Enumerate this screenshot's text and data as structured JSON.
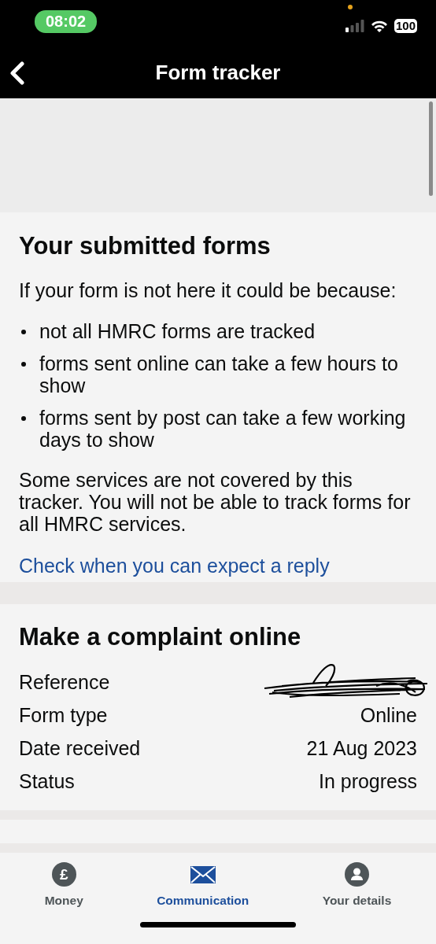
{
  "status_bar": {
    "time": "08:02",
    "battery": "100"
  },
  "nav": {
    "title": "Form tracker"
  },
  "intro_card": {
    "title": "Your submitted forms",
    "lead": "If your form is not here it could be because:",
    "bullets": [
      "not all HMRC forms are tracked",
      "forms sent online can take a few hours to show",
      "forms sent by post can take a few working days to show"
    ],
    "note": "Some services are not covered by this tracker. You will not be able to track forms for all HMRC services.",
    "link": "Check when you can expect a reply"
  },
  "form_card": {
    "title": "Make a complaint online",
    "rows": [
      {
        "label": "Reference",
        "kind": "redacted"
      },
      {
        "label": "Form type",
        "kind": "text",
        "value": "Online"
      },
      {
        "label": "Date received",
        "kind": "text",
        "value": "21 Aug 2023"
      },
      {
        "label": "Status",
        "kind": "text",
        "value": "In progress"
      }
    ]
  },
  "tab_bar": [
    {
      "label": "Money",
      "kind": "glyph",
      "glyph": "£",
      "selected": false
    },
    {
      "label": "Communication",
      "kind": "envelope",
      "selected": true
    },
    {
      "label": "Your details",
      "kind": "person",
      "selected": false
    }
  ]
}
